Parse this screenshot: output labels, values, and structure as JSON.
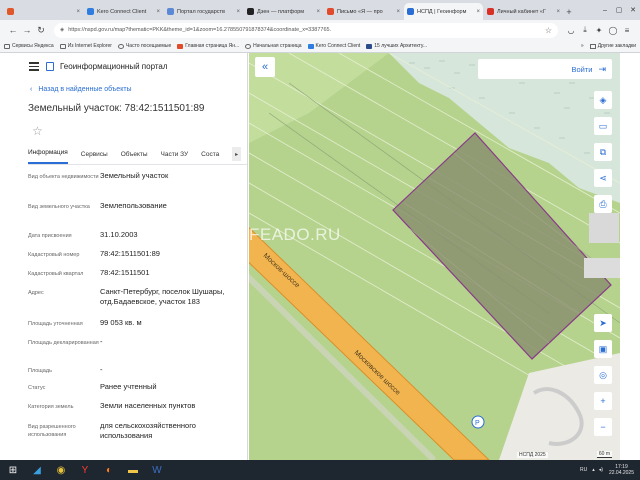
{
  "browser": {
    "tabs": [
      {
        "label": "",
        "color": "#e0572a"
      },
      {
        "label": "Kero Connect Client",
        "color": "#2f7de1"
      },
      {
        "label": "Портал государств",
        "color": "#5a8ad6"
      },
      {
        "label": "Дзен — платформ",
        "color": "#222222"
      },
      {
        "label": "Письмо «Я — про",
        "color": "#e14a2a"
      },
      {
        "label": "НСПД | Геоинформ",
        "color": "#2a6dd4",
        "active": true
      },
      {
        "label": "Личный кабинет «Г",
        "color": "#d93025"
      }
    ],
    "new_tab": "+",
    "url": "https://nspd.gov.ru/map?thematic=PKK&theme_id=1&zoom=16.278550791878374&coordinate_x=3387765.",
    "bookmarks": [
      "Сервисы Яндекса",
      "Из Internet Explorer",
      "Часто посещаемые",
      "Главная страница Ян...",
      "Начальная страница",
      "Kero Connect Client",
      "15 лучших Архитекту..."
    ],
    "other_bookmarks": "Другие закладки"
  },
  "panel": {
    "portal_title": "Геоинформационный портал",
    "back_label": "Назад в найденные объекты",
    "object_title": "Земельный участок: 78:42:1511501:89",
    "tabs": [
      "Информация",
      "Сервисы",
      "Объекты",
      "Части ЗУ",
      "Соста"
    ],
    "properties": [
      {
        "key": "Вид объекта недвижимости",
        "value": "Земельный участок"
      },
      {
        "key": "Вид земельного участка",
        "value": "Землепользование"
      },
      {
        "key": "Дата присвоения",
        "value": "31.10.2003"
      },
      {
        "key": "Кадастровый номер",
        "value": "78:42:1511501:89"
      },
      {
        "key": "Кадастровый квартал",
        "value": "78:42:1511501"
      },
      {
        "key": "Адрес",
        "value": "Санкт-Петербург, поселок Шушары, отд.Бадаевское, участок 183"
      },
      {
        "key": "Площадь уточненная",
        "value": "99 053 кв. м"
      },
      {
        "key": "Площадь декларированная",
        "value": "-"
      },
      {
        "key": "Площадь",
        "value": "-"
      },
      {
        "key": "Статус",
        "value": "Ранее учтенный"
      },
      {
        "key": "Категория земель",
        "value": "Земли населенных пунктов"
      },
      {
        "key": "Вид разрешенного использования",
        "value": "для сельскохозяйственного использования"
      }
    ]
  },
  "map": {
    "login_label": "Войти",
    "road_label_1": "Москов-шоссе",
    "road_label_2": "Московское шоссе",
    "copyright": "НСПД 2025",
    "scale_label": "60 m",
    "watermark": "FEADO.RU",
    "parcel_fill": "#8a8f6f",
    "parcel_stroke": "#8a3a8a"
  },
  "taskbar": {
    "lang": "RU",
    "time": "17:19",
    "date": "22.04.2025"
  }
}
